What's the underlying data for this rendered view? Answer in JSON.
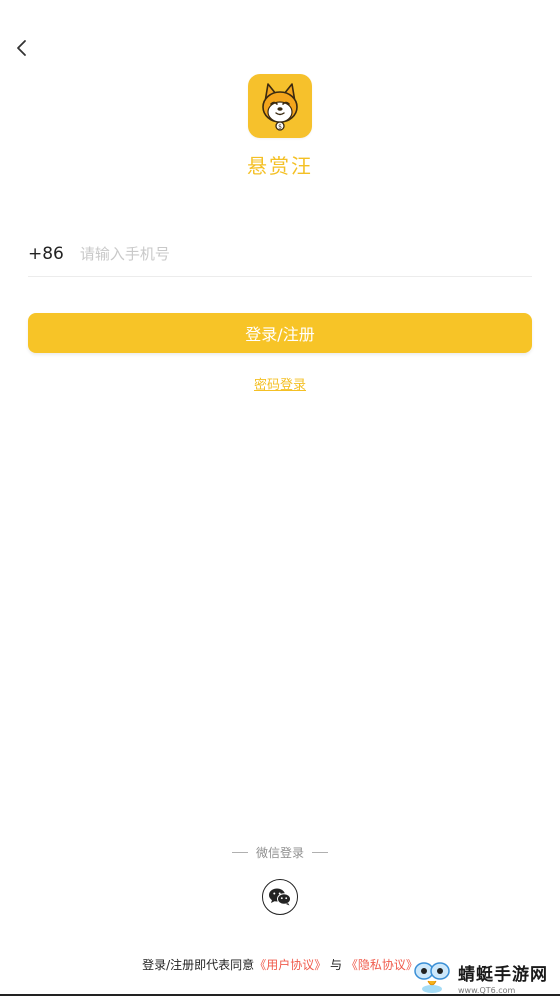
{
  "app": {
    "name": "悬赏汪"
  },
  "phone": {
    "country_code": "+86",
    "placeholder": "请输入手机号",
    "value": ""
  },
  "buttons": {
    "login_register": "登录/注册",
    "password_login": "密码登录"
  },
  "wechat": {
    "title": "微信登录",
    "icon": "wechat-icon"
  },
  "agreement": {
    "prefix": "登录/注册即代表同意",
    "user_agreement": "《用户协议》",
    "and": " 与 ",
    "privacy_agreement": "《隐私协议》"
  },
  "watermark": {
    "text": "蜻蜓手游网",
    "url": "www.QT6.com"
  },
  "colors": {
    "brand": "#f7c427",
    "link": "#f05b4c",
    "text": "#222222"
  }
}
